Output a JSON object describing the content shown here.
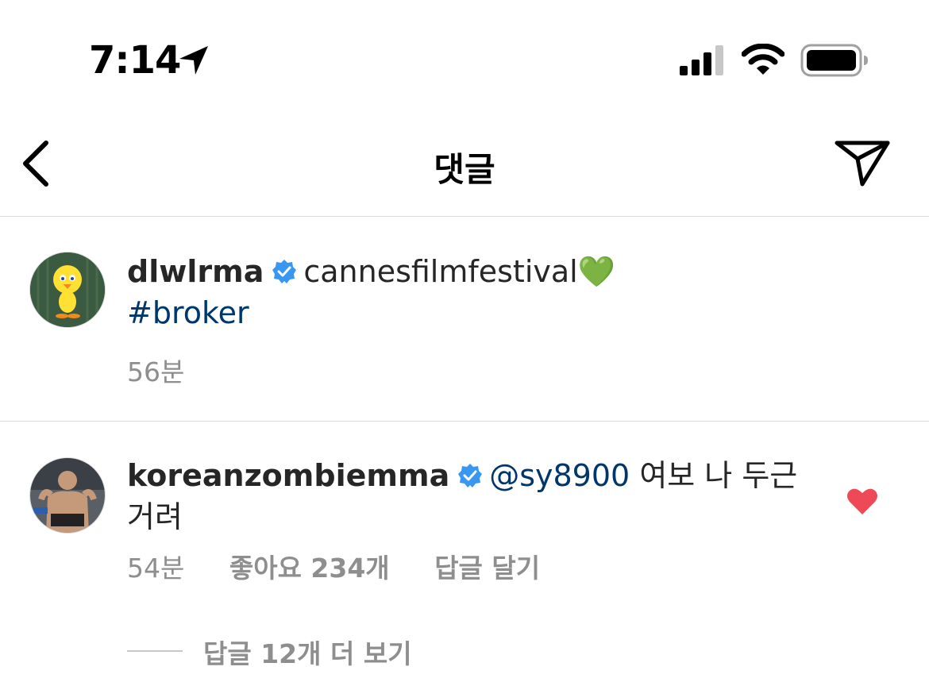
{
  "status_bar": {
    "time": "7:14",
    "icons": [
      "location-arrow-icon",
      "signal-icon",
      "wifi-icon",
      "battery-icon"
    ]
  },
  "header": {
    "title": "댓글",
    "back_icon": "chevron-left-icon",
    "share_icon": "paper-plane-icon"
  },
  "caption": {
    "username": "dlwlrma",
    "verified": true,
    "text": "cannesfilmfestival💚",
    "hashtag": "#broker",
    "time": "56분"
  },
  "comment": {
    "username": "koreanzombiemma",
    "verified": true,
    "mention": "@sy8900",
    "text": "여보 나 두근거려",
    "time": "54분",
    "likes": "좋아요 234개",
    "reply_label": "답글 달기",
    "liked": true,
    "view_replies": "답글 12개 더 보기"
  },
  "colors": {
    "link": "#00376b",
    "meta": "#8e8e8e",
    "verified": "#3897f0",
    "heart": "#ed4956"
  }
}
